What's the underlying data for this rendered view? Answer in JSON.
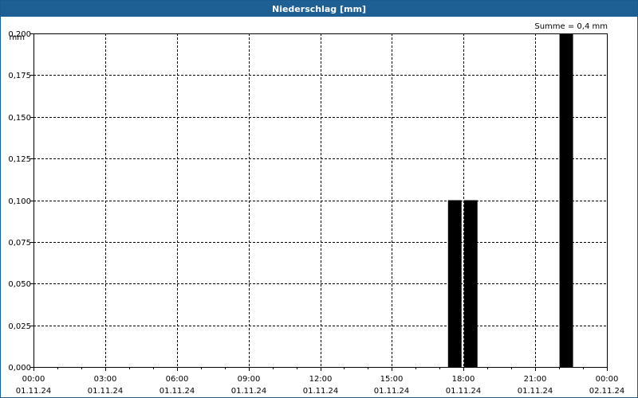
{
  "window": {
    "title": "Niederschlag [mm]"
  },
  "sum_label": "Summe = 0,4 mm",
  "colors": {
    "titlebar": "#1e5f94",
    "bar": "#000000",
    "grid": "#000000"
  },
  "chart_data": {
    "type": "bar",
    "title": "Niederschlag [mm]",
    "ylabel": "mm",
    "ylim": [
      0,
      0.2
    ],
    "xlim_hours": [
      0,
      24
    ],
    "grid": true,
    "y_ticks": [
      "0,000",
      "0,025",
      "0,050",
      "0,075",
      "0,100",
      "0,125",
      "0,150",
      "0,175",
      "0,200"
    ],
    "x_ticks": [
      {
        "time": "00:00",
        "date": "01.11.24"
      },
      {
        "time": "03:00",
        "date": "01.11.24"
      },
      {
        "time": "06:00",
        "date": "01.11.24"
      },
      {
        "time": "09:00",
        "date": "01.11.24"
      },
      {
        "time": "12:00",
        "date": "01.11.24"
      },
      {
        "time": "15:00",
        "date": "01.11.24"
      },
      {
        "time": "18:00",
        "date": "01.11.24"
      },
      {
        "time": "21:00",
        "date": "01.11.24"
      },
      {
        "time": "00:00",
        "date": "02.11.24"
      }
    ],
    "bars": [
      {
        "start": "01.11.24 17:20",
        "end": "01.11.24 18:00",
        "value": 0.1
      },
      {
        "start": "01.11.24 18:00",
        "end": "01.11.24 18:40",
        "value": 0.1
      },
      {
        "start": "01.11.24 22:00",
        "end": "01.11.24 22:40",
        "value": 0.2
      }
    ]
  }
}
